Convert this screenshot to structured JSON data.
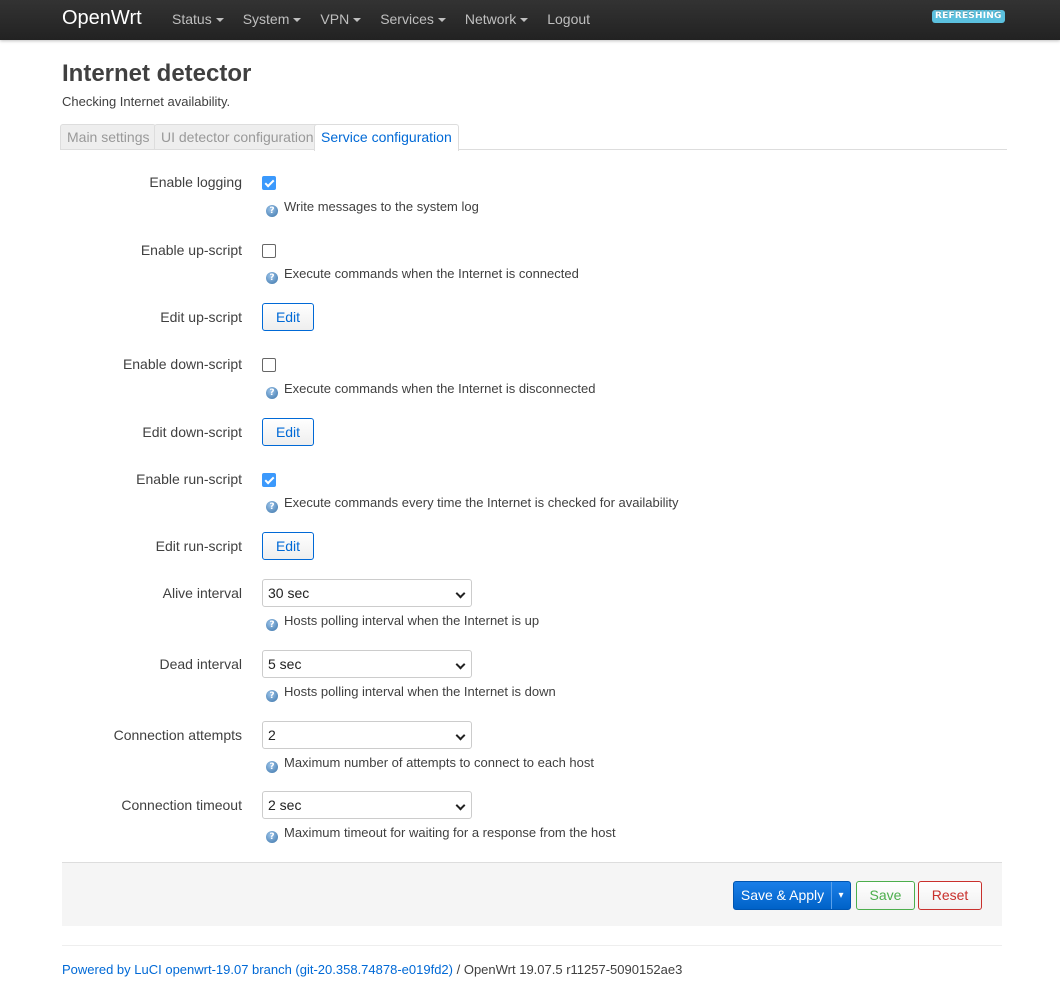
{
  "navbar": {
    "brand": "OpenWrt",
    "menu": [
      {
        "label": "Status",
        "dropdown": true
      },
      {
        "label": "System",
        "dropdown": true
      },
      {
        "label": "VPN",
        "dropdown": true
      },
      {
        "label": "Services",
        "dropdown": true
      },
      {
        "label": "Network",
        "dropdown": true
      },
      {
        "label": "Logout",
        "dropdown": false
      }
    ],
    "indicator": "REFRESHING"
  },
  "page": {
    "title": "Internet detector",
    "description": "Checking Internet availability."
  },
  "tabs": [
    {
      "label": "Main settings",
      "active": false
    },
    {
      "label": "UI detector configuration",
      "active": false
    },
    {
      "label": "Service configuration",
      "active": true
    }
  ],
  "form": {
    "enable_logging": {
      "label": "Enable logging",
      "checked": true,
      "help": "Write messages to the system log"
    },
    "enable_up_script": {
      "label": "Enable up-script",
      "checked": false,
      "help": "Execute commands when the Internet is connected"
    },
    "edit_up_script": {
      "label": "Edit up-script",
      "button": "Edit"
    },
    "enable_down_script": {
      "label": "Enable down-script",
      "checked": false,
      "help": "Execute commands when the Internet is disconnected"
    },
    "edit_down_script": {
      "label": "Edit down-script",
      "button": "Edit"
    },
    "enable_run_script": {
      "label": "Enable run-script",
      "checked": true,
      "help": "Execute commands every time the Internet is checked for availability"
    },
    "edit_run_script": {
      "label": "Edit run-script",
      "button": "Edit"
    },
    "alive_interval": {
      "label": "Alive interval",
      "value": "30 sec",
      "help": "Hosts polling interval when the Internet is up"
    },
    "dead_interval": {
      "label": "Dead interval",
      "value": "5 sec",
      "help": "Hosts polling interval when the Internet is down"
    },
    "connection_attempts": {
      "label": "Connection attempts",
      "value": "2",
      "help": "Maximum number of attempts to connect to each host"
    },
    "connection_timeout": {
      "label": "Connection timeout",
      "value": "2 sec",
      "help": "Maximum timeout for waiting for a response from the host"
    }
  },
  "actions": {
    "save_apply": "Save & Apply",
    "save_apply_dropdown": "▾",
    "save": "Save",
    "reset": "Reset"
  },
  "footer": {
    "link": "Powered by LuCI openwrt-19.07 branch (git-20.358.74878-e019fd2)",
    "separator": " / ",
    "version": "OpenWrt 19.07.5 r11257-5090152ae3"
  },
  "icons": {
    "help": "info-icon",
    "caret": "caret-down-icon",
    "select_arrow": "chevron-down-icon"
  },
  "colors": {
    "navbar": "#222222",
    "accent": "#0069d6",
    "checkbox_checked": "#3b99fc",
    "indicator": "#5bc0de",
    "save": "#4cae4c",
    "reset": "#c9302c"
  }
}
